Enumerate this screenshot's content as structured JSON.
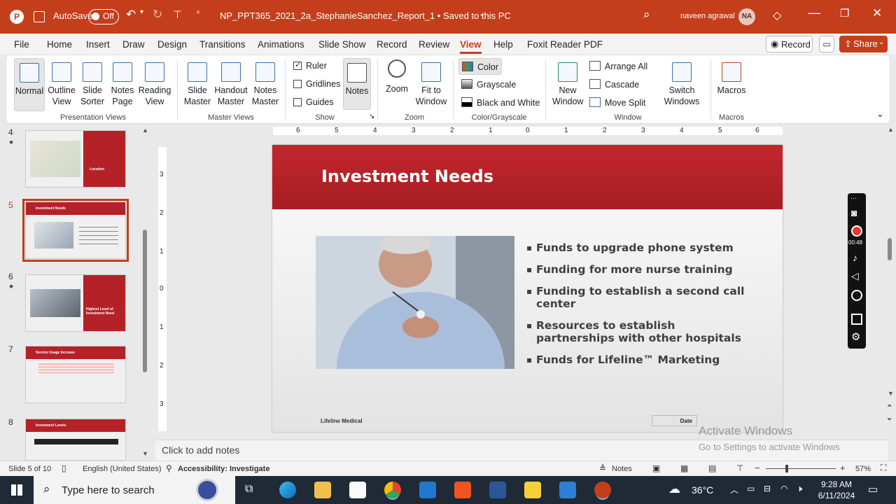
{
  "titlebar": {
    "autosave_label": "AutoSave",
    "autosave_state": "Off",
    "doc_title": "NP_PPT365_2021_2a_StephanieSanchez_Report_1 • Saved to this PC",
    "user_name": "naveen agrawal",
    "user_initials": "NA",
    "accent_color": "#c43e1c"
  },
  "menu": {
    "tabs": [
      "File",
      "Home",
      "Insert",
      "Draw",
      "Design",
      "Transitions",
      "Animations",
      "Slide Show",
      "Record",
      "Review",
      "View",
      "Help",
      "Foxit Reader PDF"
    ],
    "active_tab": "View",
    "record_label": "Record",
    "share_label": "Share"
  },
  "ribbon": {
    "presentation_views": [
      "Normal",
      "Outline View",
      "Slide Sorter",
      "Notes Page",
      "Reading View"
    ],
    "master_views": [
      "Slide Master",
      "Handout Master",
      "Notes Master"
    ],
    "show": {
      "ruler": "Ruler",
      "gridlines": "Gridlines",
      "guides": "Guides",
      "notes": "Notes"
    },
    "zoom": [
      "Zoom",
      "Fit to Window"
    ],
    "color_grayscale": [
      "Color",
      "Grayscale",
      "Black and White"
    ],
    "window": {
      "new_window": "New Window",
      "arrange_all": "Arrange All",
      "cascade": "Cascade",
      "move_split": "Move Split",
      "switch_windows": "Switch Windows"
    },
    "macros": "Macros",
    "groups": [
      "Presentation Views",
      "Master Views",
      "Show",
      "Zoom",
      "Color/Grayscale",
      "Window",
      "Macros"
    ]
  },
  "thumbnails": [
    {
      "num": "4",
      "title": "Location"
    },
    {
      "num": "5",
      "title": "Investment Needs"
    },
    {
      "num": "6",
      "title": "Highest Level of Investment Need"
    },
    {
      "num": "7",
      "title": "Service Usage Increase"
    },
    {
      "num": "8",
      "title": "Investment Levels"
    }
  ],
  "rulers": {
    "horizontal": [
      "6",
      "5",
      "4",
      "3",
      "2",
      "1",
      "0",
      "1",
      "2",
      "3",
      "4",
      "5",
      "6"
    ],
    "vertical": [
      "3",
      "2",
      "1",
      "0",
      "1",
      "2",
      "3"
    ]
  },
  "slide": {
    "title": "Investment Needs",
    "bullets": [
      "Funds to upgrade phone system",
      "Funding for more nurse training",
      "Funding to establish a second call center",
      "Resources to establish partnerships with other hospitals",
      "Funds for Lifeline™ Marketing"
    ],
    "footer": "Lifeline Medical",
    "date": "Date"
  },
  "notes_placeholder": "Click to add notes",
  "activation": {
    "line1": "Activate Windows",
    "line2": "Go to Settings to activate Windows"
  },
  "recorder": {
    "timer": "00:48"
  },
  "statusbar": {
    "slide_info": "Slide 5 of 10",
    "language": "English (United States)",
    "accessibility": "Accessibility: Investigate",
    "notes": "Notes",
    "zoom": "57%"
  },
  "taskbar": {
    "search_placeholder": "Type here to search",
    "temperature": "36°C",
    "time": "9:28 AM",
    "date": "6/11/2024"
  }
}
